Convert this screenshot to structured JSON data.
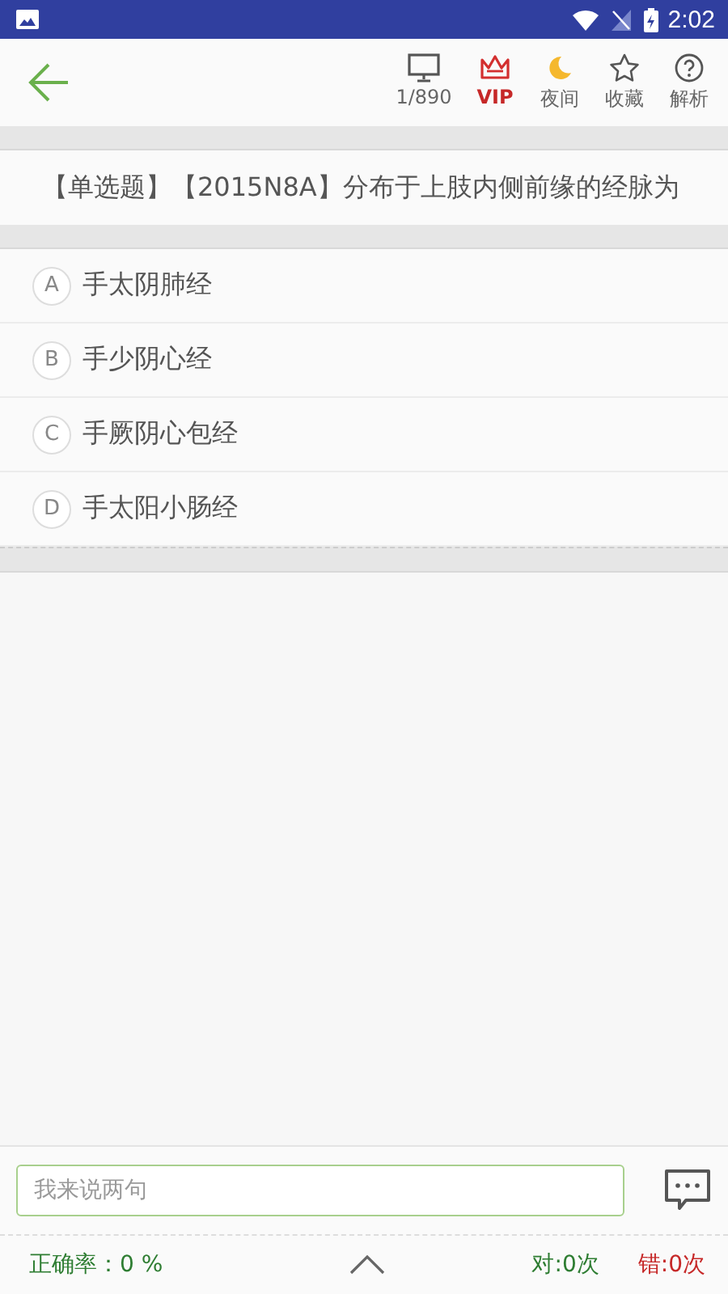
{
  "status_bar": {
    "time": "2:02"
  },
  "toolbar": {
    "actions": [
      {
        "kind": "screen",
        "label": "1/890"
      },
      {
        "kind": "vip",
        "label": "VIP"
      },
      {
        "kind": "night",
        "label": "夜间"
      },
      {
        "kind": "star",
        "label": "收藏"
      },
      {
        "kind": "help",
        "label": "解析"
      }
    ]
  },
  "question": {
    "text": "【单选题】【2015N8A】分布于上肢内侧前缘的经脉为"
  },
  "options": [
    {
      "letter": "A",
      "text": "手太阴肺经"
    },
    {
      "letter": "B",
      "text": "手少阴心经"
    },
    {
      "letter": "C",
      "text": "手厥阴心包经"
    },
    {
      "letter": "D",
      "text": "手太阳小肠经"
    }
  ],
  "comment": {
    "placeholder": "我来说两句"
  },
  "footer": {
    "accuracy": "正确率：0 %",
    "correct": "对:0次",
    "wrong": "错:0次"
  }
}
